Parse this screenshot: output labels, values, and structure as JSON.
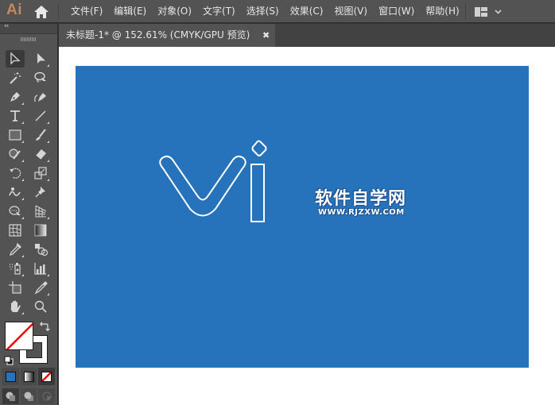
{
  "app": {
    "logo_text": "Ai",
    "home_icon": "home-icon"
  },
  "menu": {
    "items": [
      {
        "label": "文件(F)"
      },
      {
        "label": "编辑(E)"
      },
      {
        "label": "对象(O)"
      },
      {
        "label": "文字(T)"
      },
      {
        "label": "选择(S)"
      },
      {
        "label": "效果(C)"
      },
      {
        "label": "视图(V)"
      },
      {
        "label": "窗口(W)"
      },
      {
        "label": "帮助(H)"
      }
    ],
    "workspace_icon": "workspace-layout-icon",
    "workspace_chevron": "chevron-down-icon"
  },
  "toolbar": {
    "collapse_label": "‹‹",
    "tools": [
      {
        "name": "selection-tool",
        "active": true
      },
      {
        "name": "direct-selection-tool"
      },
      {
        "name": "magic-wand-tool"
      },
      {
        "name": "lasso-tool"
      },
      {
        "name": "pen-tool"
      },
      {
        "name": "curvature-tool"
      },
      {
        "name": "type-tool"
      },
      {
        "name": "line-segment-tool"
      },
      {
        "name": "rectangle-tool"
      },
      {
        "name": "paintbrush-tool"
      },
      {
        "name": "shaper-tool"
      },
      {
        "name": "eraser-tool"
      },
      {
        "name": "rotate-tool"
      },
      {
        "name": "scale-tool"
      },
      {
        "name": "warp-tool"
      },
      {
        "name": "puppet-warp-tool"
      },
      {
        "name": "shape-builder-tool"
      },
      {
        "name": "perspective-grid-tool"
      },
      {
        "name": "mesh-tool"
      },
      {
        "name": "gradient-tool"
      },
      {
        "name": "eyedropper-tool"
      },
      {
        "name": "blend-tool"
      },
      {
        "name": "symbol-sprayer-tool"
      },
      {
        "name": "column-graph-tool"
      },
      {
        "name": "artboard-tool"
      },
      {
        "name": "slice-tool"
      },
      {
        "name": "hand-tool"
      },
      {
        "name": "zoom-tool"
      }
    ],
    "fill": "none",
    "stroke": "#ffffff",
    "color_modes": [
      "color",
      "gradient",
      "none"
    ],
    "draw_modes": [
      "draw-normal",
      "draw-behind",
      "draw-inside"
    ]
  },
  "document": {
    "tab_title": "未标题-1* @ 152.61% (CMYK/GPU 预览)",
    "close_label": "✖",
    "zoom": "152.61%",
    "color_mode": "CMYK/GPU 预览"
  },
  "artboard": {
    "background": "#2673bb",
    "artwork": "vi-logo-outline",
    "stroke_color": "#ffffff"
  },
  "watermark": {
    "cn": "软件自学网",
    "url": "WWW.RJZXW.COM"
  }
}
